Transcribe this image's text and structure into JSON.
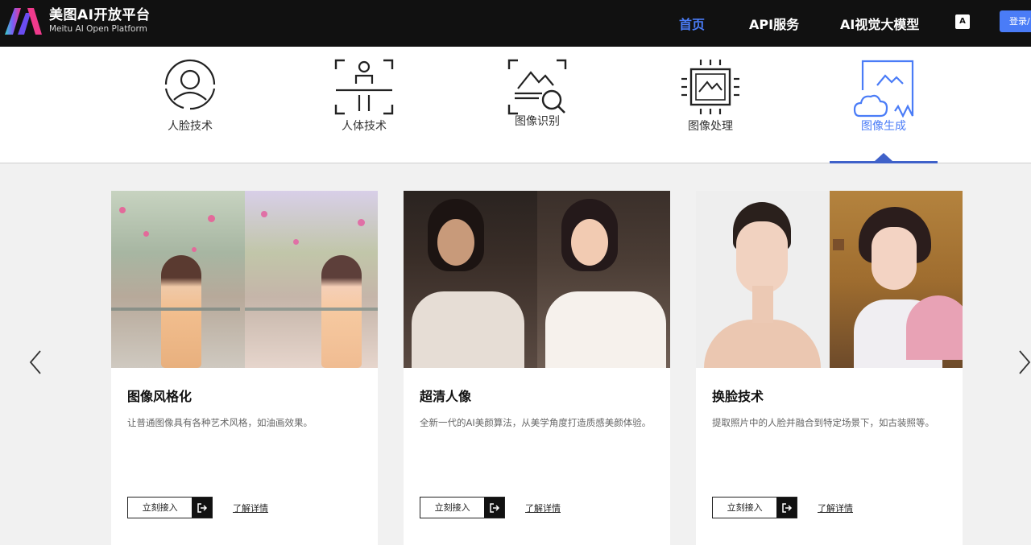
{
  "brand": {
    "name_cn": "美图AI开放平台",
    "name_en": "Meitu AI Open Platform"
  },
  "nav": {
    "home": "首页",
    "api": "API服务",
    "model": "AI视觉大模型",
    "lang_icon": "A",
    "login": "登录/"
  },
  "categories": [
    {
      "label": "人脸技术",
      "icon": "face-icon"
    },
    {
      "label": "人体技术",
      "icon": "body-icon"
    },
    {
      "label": "图像识别",
      "icon": "image-recognition-icon"
    },
    {
      "label": "图像处理",
      "icon": "image-processing-icon"
    },
    {
      "label": "图像生成",
      "icon": "image-generation-icon",
      "active": true
    }
  ],
  "cards": [
    {
      "title": "图像风格化",
      "desc": "让普通图像具有各种艺术风格，如油画效果。",
      "access": "立刻接入",
      "detail": "了解详情"
    },
    {
      "title": "超清人像",
      "desc": "全新一代的AI美颜算法，从美学角度打造质感美颜体验。",
      "access": "立刻接入",
      "detail": "了解详情"
    },
    {
      "title": "换脸技术",
      "desc": "提取照片中的人脸并融合到特定场景下，如古装照等。",
      "access": "立刻接入",
      "detail": "了解详情"
    }
  ],
  "colors": {
    "accent": "#4a7cf7",
    "nav_bg": "#111111",
    "active_underline": "#3f61c9"
  }
}
